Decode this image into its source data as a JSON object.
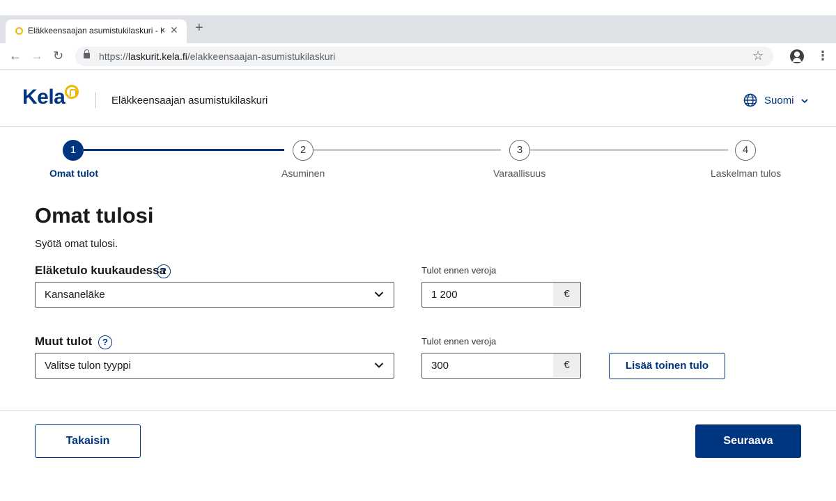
{
  "browser": {
    "tab_title": "Eläkkeensaajan asumistukilaskuri - Kela",
    "tab_close": "✕",
    "new_tab": "+",
    "url_scheme": "https://",
    "url_host": "laskurit.kela.fi",
    "url_path": "/elakkeensaajan-asumistukilaskuri",
    "back": "←",
    "forward": "→",
    "reload": "↻",
    "star": "☆",
    "menu": "⋮"
  },
  "header": {
    "logo_text": "Kela",
    "app_title": "Eläkkeensaajan asumistukilaskuri",
    "language": "Suomi"
  },
  "stepper": {
    "steps": [
      {
        "number": "1",
        "label": "Omat tulot",
        "active": true
      },
      {
        "number": "2",
        "label": "Asuminen",
        "active": false
      },
      {
        "number": "3",
        "label": "Varaallisuus",
        "active": false
      },
      {
        "number": "4",
        "label": "Laskelman tulos",
        "active": false
      }
    ]
  },
  "form": {
    "title": "Omat tulosi",
    "intro": "Syötä omat tulosi.",
    "pension": {
      "label": "Eläketulo kuukaudessa",
      "help": "?",
      "select_value": "Kansaneläke",
      "amount_label": "Tulot ennen veroja",
      "amount_value": "1 200",
      "currency": "€"
    },
    "other": {
      "label": "Muut tulot",
      "help": "?",
      "select_value": "Valitse tulon tyyppi",
      "amount_label": "Tulot ennen veroja",
      "amount_value": "300",
      "currency": "€",
      "add_button": "Lisää toinen tulo"
    }
  },
  "footer": {
    "back_button": "Takaisin",
    "next_button": "Seuraava"
  },
  "colors": {
    "brand_blue": "#003580",
    "brand_yellow": "#f2b705",
    "inactive_line": "#cccccc"
  }
}
